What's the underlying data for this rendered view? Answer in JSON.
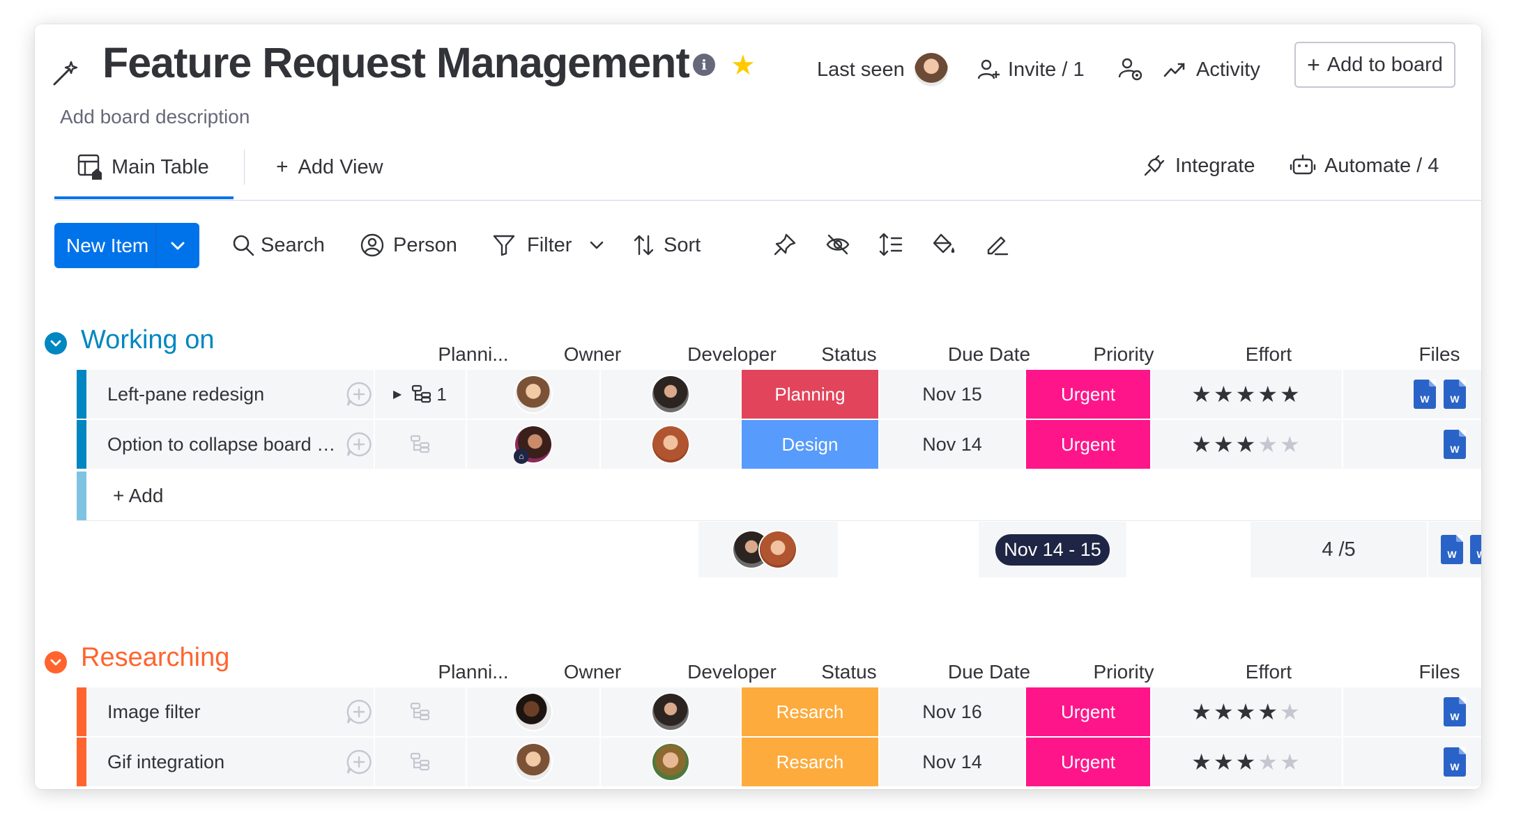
{
  "board": {
    "title": "Feature Request Management",
    "description": "Add board description",
    "last_seen_label": "Last seen",
    "invite_label": "Invite / 1",
    "activity_label": "Activity",
    "add_to_board_label": "Add to board"
  },
  "views": {
    "main_table_label": "Main Table",
    "add_view_label": "Add View",
    "integrate_label": "Integrate",
    "automate_label": "Automate / 4"
  },
  "toolbar": {
    "new_item_label": "New Item",
    "search_label": "Search",
    "person_label": "Person",
    "filter_label": "Filter",
    "sort_label": "Sort"
  },
  "columns": {
    "planning": "Planni...",
    "owner": "Owner",
    "developer": "Developer",
    "status": "Status",
    "due_date": "Due Date",
    "priority": "Priority",
    "effort": "Effort",
    "files": "Files"
  },
  "groups": [
    {
      "title": "Working on",
      "color": "#0086c0",
      "rows": [
        {
          "name": "Left-pane redesign",
          "subitems": "1",
          "status": "Planning",
          "status_color": "#e2445c",
          "due": "Nov 15",
          "priority": "Urgent",
          "priority_color": "#ff158a",
          "effort": 5,
          "files": [
            "W",
            "W"
          ]
        },
        {
          "name": "Option to collapse board hea...",
          "subitems": "",
          "status": "Design",
          "status_color": "#579bfc",
          "due": "Nov 14",
          "priority": "Urgent",
          "priority_color": "#ff158a",
          "effort": 3,
          "files": [
            "W"
          ]
        }
      ],
      "add_label": "+ Add",
      "summary": {
        "due_range": "Nov 14 - 15",
        "effort": "4 /5",
        "files": [
          "W",
          "W",
          "W"
        ]
      }
    },
    {
      "title": "Researching",
      "color": "#ff642e",
      "rows": [
        {
          "name": "Image filter",
          "status": "Resarch",
          "status_color": "#fdab3d",
          "due": "Nov 16",
          "priority": "Urgent",
          "priority_color": "#ff158a",
          "effort": 4,
          "files": [
            "W"
          ]
        },
        {
          "name": "Gif integration",
          "status": "Resarch",
          "status_color": "#fdab3d",
          "due": "Nov 14",
          "priority": "Urgent",
          "priority_color": "#ff158a",
          "effort": 3,
          "files": [
            "W"
          ]
        }
      ]
    }
  ],
  "effort_max": 5,
  "colors": {
    "primary": "#0073ea",
    "star": "#ffcb00"
  }
}
